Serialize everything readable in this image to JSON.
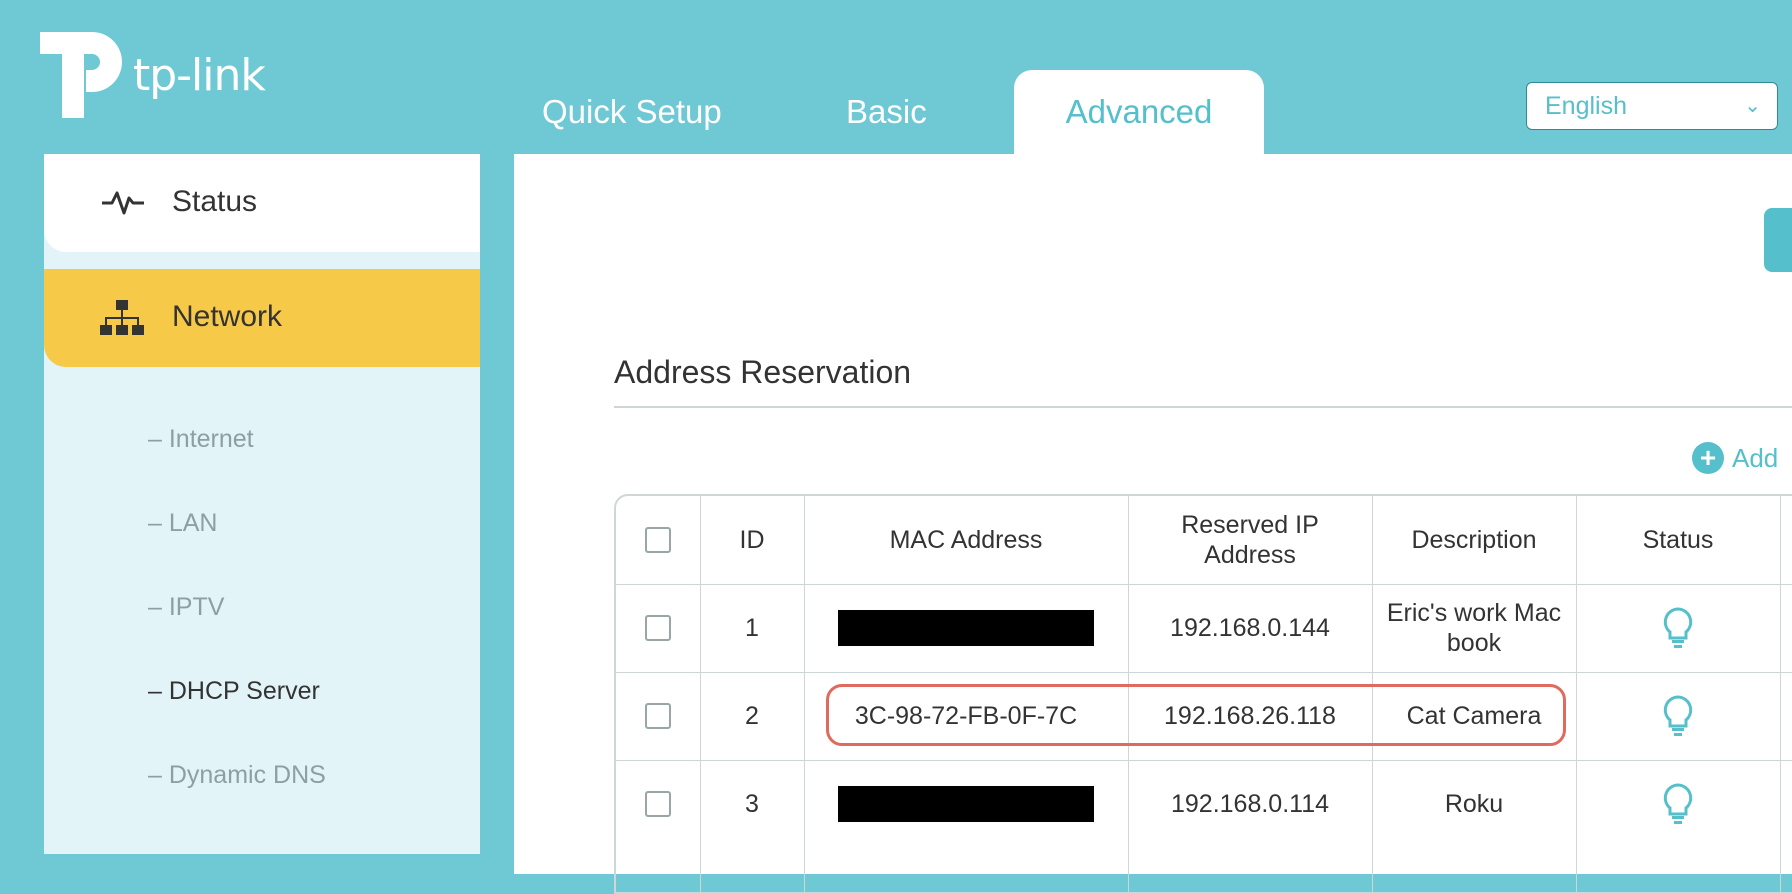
{
  "header": {
    "logo_text": "tp-link",
    "tabs": [
      {
        "label": "Quick Setup"
      },
      {
        "label": "Basic"
      },
      {
        "label": "Advanced"
      }
    ],
    "language": "English"
  },
  "sidebar": {
    "items": [
      {
        "label": "Status",
        "icon": "pulse-icon"
      },
      {
        "label": "Network",
        "icon": "network-icon"
      }
    ],
    "sub_items": [
      {
        "label": "– Internet"
      },
      {
        "label": "– LAN"
      },
      {
        "label": "– IPTV"
      },
      {
        "label": "– DHCP Server"
      },
      {
        "label": "– Dynamic DNS"
      }
    ]
  },
  "main": {
    "section_title": "Address Reservation",
    "add_label": "Add",
    "table": {
      "headers": [
        "ID",
        "MAC Address",
        "Reserved IP Address",
        "Description",
        "Status"
      ],
      "rows": [
        {
          "id": "1",
          "mac": "",
          "ip": "192.168.0.144",
          "description": "Eric's work Mac book"
        },
        {
          "id": "2",
          "mac": "3C-98-72-FB-0F-7C",
          "ip": "192.168.26.118",
          "description": "Cat Camera"
        },
        {
          "id": "3",
          "mac": "",
          "ip": "192.168.0.114",
          "description": "Roku"
        }
      ]
    }
  },
  "colors": {
    "brand": "#6ec9d4",
    "accent": "#55bfcc",
    "network_active": "#f7c948",
    "highlight": "#e06a5e"
  }
}
